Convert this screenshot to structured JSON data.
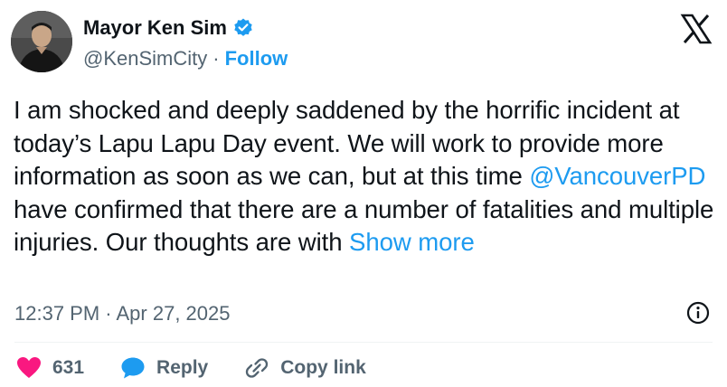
{
  "author": {
    "display_name": "Mayor Ken Sim",
    "handle": "@KenSimCity",
    "separator": "·",
    "follow_label": "Follow",
    "verified": true
  },
  "tweet": {
    "text_part1": "I am shocked and deeply saddened by the horrific incident at today’s Lapu Lapu Day event. We will work to provide more information as soon as we can, but at this time ",
    "mention": "@VancouverPD",
    "text_part2": " have confirmed that there are a number of fatalities and multiple injuries. Our thoughts are with ",
    "show_more_label": "Show more",
    "timestamp": "12:37 PM · Apr 27, 2025"
  },
  "actions": {
    "like_count": "631",
    "reply_label": "Reply",
    "copy_link_label": "Copy link"
  },
  "icons": {
    "verified": "verified-badge-icon",
    "x_logo": "x-logo-icon",
    "info": "info-icon",
    "like": "heart-icon",
    "reply": "speech-bubble-icon",
    "copy_link": "link-icon"
  },
  "colors": {
    "accent": "#1d9bf0",
    "text": "#0f1419",
    "secondary": "#536471",
    "like": "#f91880"
  }
}
